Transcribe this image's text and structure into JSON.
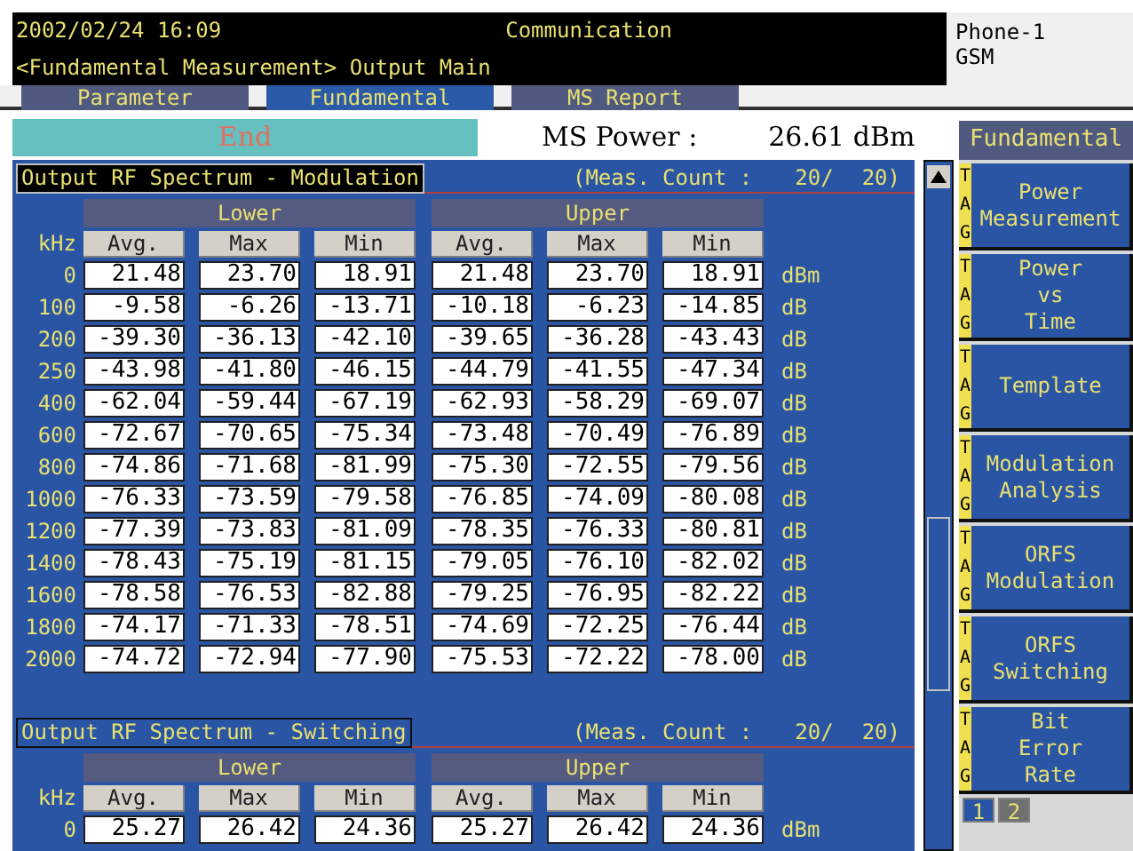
{
  "header": {
    "datetime": "2002/02/24 16:09",
    "title": "Communication",
    "path": "<Fundamental Measurement> Output Main",
    "device": [
      "Phone-1",
      "GSM"
    ]
  },
  "tabs": [
    {
      "label": "Parameter",
      "selected": false
    },
    {
      "label": "Fundamental",
      "selected": true
    },
    {
      "label": "MS Report",
      "selected": false
    }
  ],
  "status": {
    "state": "End",
    "label": "MS Power :",
    "value": "26.61 dBm"
  },
  "sections": [
    {
      "title": "Output RF Spectrum - Modulation",
      "selected": true,
      "count_label": "(Meas. Count :",
      "count": "20/",
      "total": "20)",
      "groups": [
        "Lower",
        "Upper"
      ],
      "axis": "kHz",
      "columns": [
        "Avg.",
        "Max",
        "Min",
        "Avg.",
        "Max",
        "Min"
      ],
      "rows": [
        {
          "freq": "0",
          "values": [
            "21.48",
            "23.70",
            "18.91",
            "21.48",
            "23.70",
            "18.91"
          ],
          "unit": "dBm"
        },
        {
          "freq": "100",
          "values": [
            "-9.58",
            "-6.26",
            "-13.71",
            "-10.18",
            "-6.23",
            "-14.85"
          ],
          "unit": "dB"
        },
        {
          "freq": "200",
          "values": [
            "-39.30",
            "-36.13",
            "-42.10",
            "-39.65",
            "-36.28",
            "-43.43"
          ],
          "unit": "dB"
        },
        {
          "freq": "250",
          "values": [
            "-43.98",
            "-41.80",
            "-46.15",
            "-44.79",
            "-41.55",
            "-47.34"
          ],
          "unit": "dB"
        },
        {
          "freq": "400",
          "values": [
            "-62.04",
            "-59.44",
            "-67.19",
            "-62.93",
            "-58.29",
            "-69.07"
          ],
          "unit": "dB"
        },
        {
          "freq": "600",
          "values": [
            "-72.67",
            "-70.65",
            "-75.34",
            "-73.48",
            "-70.49",
            "-76.89"
          ],
          "unit": "dB"
        },
        {
          "freq": "800",
          "values": [
            "-74.86",
            "-71.68",
            "-81.99",
            "-75.30",
            "-72.55",
            "-79.56"
          ],
          "unit": "dB"
        },
        {
          "freq": "1000",
          "values": [
            "-76.33",
            "-73.59",
            "-79.58",
            "-76.85",
            "-74.09",
            "-80.08"
          ],
          "unit": "dB"
        },
        {
          "freq": "1200",
          "values": [
            "-77.39",
            "-73.83",
            "-81.09",
            "-78.35",
            "-76.33",
            "-80.81"
          ],
          "unit": "dB"
        },
        {
          "freq": "1400",
          "values": [
            "-78.43",
            "-75.19",
            "-81.15",
            "-79.05",
            "-76.10",
            "-82.02"
          ],
          "unit": "dB"
        },
        {
          "freq": "1600",
          "values": [
            "-78.58",
            "-76.53",
            "-82.88",
            "-79.25",
            "-76.95",
            "-82.22"
          ],
          "unit": "dB"
        },
        {
          "freq": "1800",
          "values": [
            "-74.17",
            "-71.33",
            "-78.51",
            "-74.69",
            "-72.25",
            "-76.44"
          ],
          "unit": "dB"
        },
        {
          "freq": "2000",
          "values": [
            "-74.72",
            "-72.94",
            "-77.90",
            "-75.53",
            "-72.22",
            "-78.00"
          ],
          "unit": "dB"
        }
      ]
    },
    {
      "title": "Output RF Spectrum - Switching",
      "selected": false,
      "count_label": "(Meas. Count :",
      "count": "20/",
      "total": "20)",
      "groups": [
        "Lower",
        "Upper"
      ],
      "axis": "kHz",
      "columns": [
        "Avg.",
        "Max",
        "Min",
        "Avg.",
        "Max",
        "Min"
      ],
      "rows": [
        {
          "freq": "0",
          "values": [
            "25.27",
            "26.42",
            "24.36",
            "25.27",
            "26.42",
            "24.36"
          ],
          "unit": "dBm"
        }
      ]
    }
  ],
  "side": {
    "title": "Fundamental",
    "buttons": [
      {
        "tag": "TAG",
        "lines": [
          "Power",
          "Measurement"
        ]
      },
      {
        "tag": "TAG",
        "lines": [
          "Power",
          "vs",
          "Time"
        ]
      },
      {
        "tag": "TAG",
        "lines": [
          "Template"
        ]
      },
      {
        "tag": "TAG",
        "lines": [
          "Modulation",
          "Analysis"
        ]
      },
      {
        "tag": "TAG",
        "lines": [
          "ORFS",
          "Modulation"
        ]
      },
      {
        "tag": "TAG",
        "lines": [
          "ORFS",
          "Switching"
        ]
      },
      {
        "tag": "TAG",
        "lines": [
          "Bit",
          "Error",
          "Rate"
        ]
      }
    ],
    "pages": [
      {
        "label": "1",
        "selected": true
      },
      {
        "label": "2",
        "selected": false
      }
    ]
  }
}
